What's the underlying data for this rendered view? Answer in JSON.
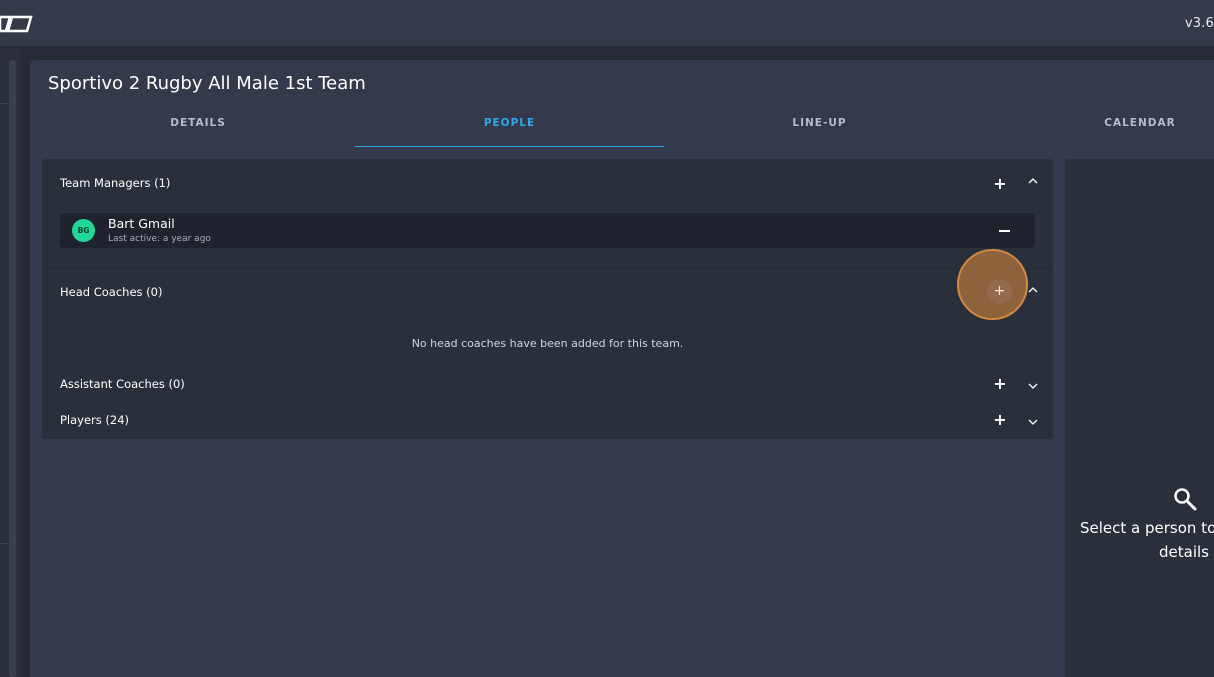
{
  "header": {
    "version": "v3.6",
    "logo_icon": "sportivo-logo-icon"
  },
  "page": {
    "title": "Sportivo 2 Rugby All Male 1st Team"
  },
  "tabs": [
    {
      "label": "DETAILS",
      "active": false
    },
    {
      "label": "PEOPLE",
      "active": true
    },
    {
      "label": "LINE-UP",
      "active": false
    },
    {
      "label": "CALENDAR",
      "active": false
    }
  ],
  "sections": {
    "team_managers": {
      "title": "Team Managers (1)",
      "members": [
        {
          "initials": "BG",
          "name": "Bart Gmail",
          "status": "Last active: a year ago"
        }
      ]
    },
    "head_coaches": {
      "title": "Head Coaches (0)",
      "empty": "No head coaches have been added for this team."
    },
    "assistant_coaches": {
      "title": "Assistant Coaches (0)"
    },
    "players": {
      "title": "Players (24)"
    }
  },
  "details_panel": {
    "line1": "Select a person to",
    "line2": "details"
  },
  "colors": {
    "accent": "#2fa8e8",
    "avatar": "#1fd89a",
    "highlight": "#d4883f"
  }
}
